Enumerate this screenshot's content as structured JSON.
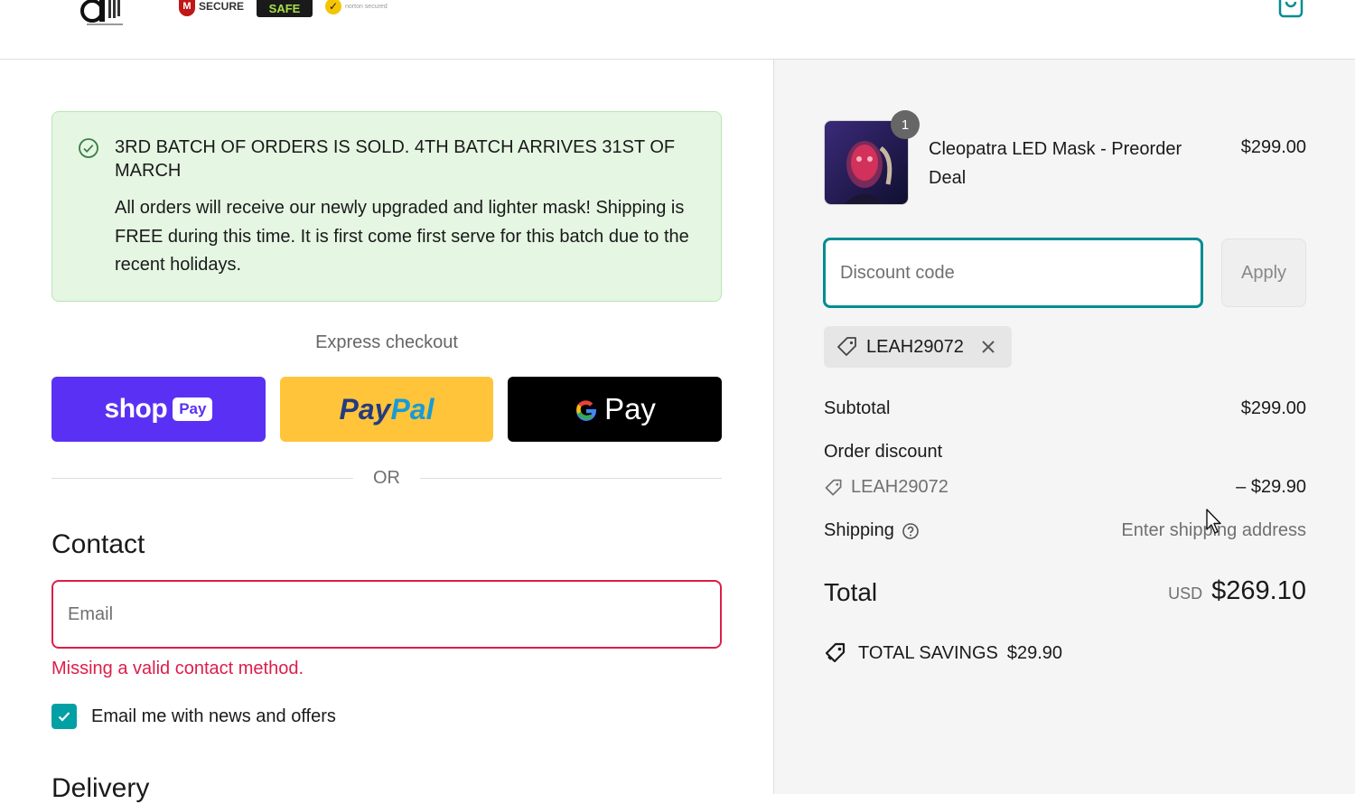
{
  "header": {
    "logo_icon": "cleopatra-logo",
    "badges": {
      "mcafee": "SECURE",
      "hacker_safe": "SAFE",
      "norton": "norton secured"
    },
    "cart_icon": "shopping-bag-icon"
  },
  "banner": {
    "icon": "check-circle-icon",
    "title": "3RD BATCH OF ORDERS IS SOLD. 4TH BATCH ARRIVES 31ST OF MARCH",
    "body": "All orders will receive our newly upgraded and lighter mask! Shipping is FREE during this time. It is first come first serve for this batch due to the recent holidays."
  },
  "express_checkout": {
    "label": "Express checkout",
    "shop_pay": {
      "word": "shop",
      "pill": "Pay"
    },
    "paypal": {
      "part1": "Pay",
      "part2": "Pal"
    },
    "gpay": {
      "g": "G",
      "pay": "Pay"
    },
    "or_label": "OR"
  },
  "contact": {
    "heading": "Contact",
    "email_placeholder": "Email",
    "email_value": "",
    "error": "Missing a valid contact method.",
    "newsletter_label": "Email me with news and offers",
    "newsletter_checked": true
  },
  "delivery": {
    "heading": "Delivery"
  },
  "summary": {
    "product": {
      "name": "Cleopatra LED Mask - Preorder Deal",
      "price": "$299.00",
      "quantity": "1"
    },
    "discount": {
      "placeholder": "Discount code",
      "value": "",
      "apply_label": "Apply",
      "applied_code": "LEAH29072"
    },
    "lines": {
      "subtotal_label": "Subtotal",
      "subtotal_value": "$299.00",
      "order_discount_label": "Order discount",
      "discount_code": "LEAH29072",
      "discount_amount": "– $29.90",
      "shipping_label": "Shipping",
      "shipping_value": "Enter shipping address"
    },
    "total": {
      "label": "Total",
      "currency": "USD",
      "amount": "$269.10"
    },
    "savings": {
      "label": "TOTAL SAVINGS",
      "amount": "$29.90"
    }
  },
  "colors": {
    "accent": "#008c91",
    "error": "#dd1d4a",
    "banner_bg": "#e5f6e3",
    "shop_pay": "#5a31f4",
    "paypal": "#ffc439"
  }
}
